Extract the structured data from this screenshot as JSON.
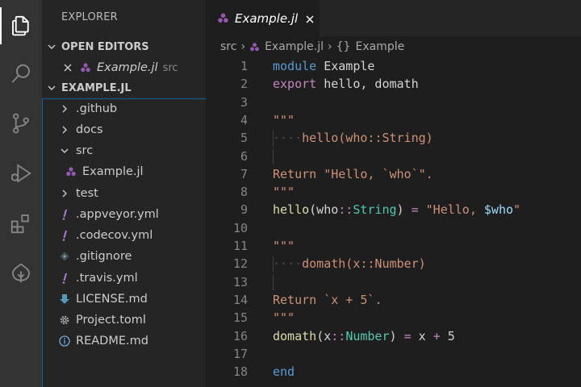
{
  "activity_bar": {
    "items": [
      {
        "name": "explorer-icon",
        "active": true
      },
      {
        "name": "search-icon",
        "active": false
      },
      {
        "name": "source-control-icon",
        "active": false
      },
      {
        "name": "run-debug-icon",
        "active": false
      },
      {
        "name": "extensions-icon",
        "active": false
      },
      {
        "name": "julia-icon",
        "active": false
      }
    ]
  },
  "sidebar": {
    "title": "EXPLORER",
    "open_editors": {
      "label": "OPEN EDITORS",
      "items": [
        {
          "name": "Example.jl",
          "folder": "src"
        }
      ]
    },
    "workspace": {
      "label": "EXAMPLE.JL",
      "items": [
        {
          "label": ".github",
          "kind": "folder-collapsed"
        },
        {
          "label": "docs",
          "kind": "folder-collapsed"
        },
        {
          "label": "src",
          "kind": "folder-expanded"
        },
        {
          "label": "Example.jl",
          "kind": "julia-file"
        },
        {
          "label": "test",
          "kind": "folder-collapsed"
        },
        {
          "label": ".appveyor.yml",
          "kind": "yaml-file"
        },
        {
          "label": ".codecov.yml",
          "kind": "yaml-file"
        },
        {
          "label": ".gitignore",
          "kind": "git-file"
        },
        {
          "label": ".travis.yml",
          "kind": "yaml-file"
        },
        {
          "label": "LICENSE.md",
          "kind": "license-file"
        },
        {
          "label": "Project.toml",
          "kind": "settings-file"
        },
        {
          "label": "README.md",
          "kind": "info-file"
        }
      ]
    }
  },
  "tabs": [
    {
      "label": "Example.jl"
    }
  ],
  "breadcrumb": {
    "folder": "src",
    "file": "Example.jl",
    "symbol": "Example"
  },
  "editor": {
    "line_numbers": [
      "1",
      "2",
      "3",
      "4",
      "5",
      "6",
      "7",
      "8",
      "9",
      "10",
      "11",
      "12",
      "13",
      "14",
      "15",
      "16",
      "17",
      "18"
    ],
    "lines": [
      [
        {
          "t": "module",
          "c": "kw-blue"
        },
        {
          "t": " Example",
          "c": "plain"
        }
      ],
      [
        {
          "t": "export",
          "c": "kw-mag"
        },
        {
          "t": " hello, domath",
          "c": "plain"
        }
      ],
      [],
      [
        {
          "t": "\"\"\"",
          "c": "str"
        }
      ],
      [
        {
          "t": "····",
          "c": "dots"
        },
        {
          "t": "hello(who::String)",
          "c": "str"
        }
      ],
      [],
      [
        {
          "t": "Return \"Hello, `who`\".",
          "c": "str"
        }
      ],
      [
        {
          "t": "\"\"\"",
          "c": "str"
        }
      ],
      [
        {
          "t": "hello",
          "c": "fn"
        },
        {
          "t": "(who",
          "c": "plain"
        },
        {
          "t": "::",
          "c": "kw-mag"
        },
        {
          "t": "String",
          "c": "typ"
        },
        {
          "t": ") ",
          "c": "plain"
        },
        {
          "t": "=",
          "c": "kw-mag"
        },
        {
          "t": " \"Hello, ",
          "c": "str"
        },
        {
          "t": "$who",
          "c": "var"
        },
        {
          "t": "\"",
          "c": "str"
        }
      ],
      [],
      [
        {
          "t": "\"\"\"",
          "c": "str"
        }
      ],
      [
        {
          "t": "····",
          "c": "dots"
        },
        {
          "t": "domath(x::Number)",
          "c": "str"
        }
      ],
      [],
      [
        {
          "t": "Return `x + 5`.",
          "c": "str"
        }
      ],
      [
        {
          "t": "\"\"\"",
          "c": "str"
        }
      ],
      [
        {
          "t": "domath",
          "c": "fn"
        },
        {
          "t": "(x",
          "c": "plain"
        },
        {
          "t": "::",
          "c": "kw-mag"
        },
        {
          "t": "Number",
          "c": "typ"
        },
        {
          "t": ") ",
          "c": "plain"
        },
        {
          "t": "=",
          "c": "kw-mag"
        },
        {
          "t": " x ",
          "c": "plain"
        },
        {
          "t": "+",
          "c": "kw-mag"
        },
        {
          "t": " 5",
          "c": "plain"
        }
      ],
      [],
      [
        {
          "t": "end",
          "c": "kw-blue"
        }
      ]
    ]
  }
}
